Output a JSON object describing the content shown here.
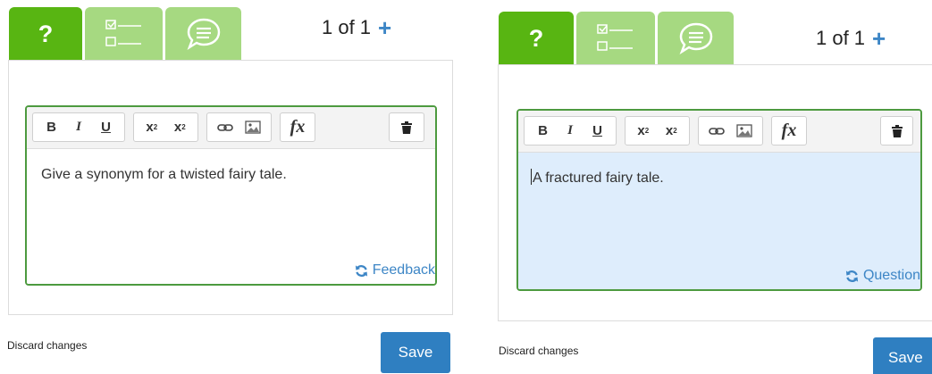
{
  "colors": {
    "tab_active": "#58b512",
    "tab_inactive": "#a6d981",
    "editor_border": "#4d9a3f",
    "link_blue": "#3d86c6",
    "save_button": "#2f7fc1",
    "answer_background": "#deedfc"
  },
  "panels": [
    {
      "tabs": [
        {
          "icon": "question-mark-icon",
          "label": "?",
          "active": true
        },
        {
          "icon": "checklist-icon",
          "active": false
        },
        {
          "icon": "speech-bubble-icon",
          "active": false
        }
      ],
      "counter": {
        "text": "1 of 1",
        "plus_icon": "plus-icon"
      },
      "toolbar": {
        "bold": "B",
        "italic": "I",
        "underline": "U",
        "superscript_icon": "superscript-icon",
        "subscript_icon": "subscript-icon",
        "link_icon": "link-icon",
        "image_icon": "image-icon",
        "formula": "fx",
        "delete_icon": "trash-icon"
      },
      "editor_text": "Give a synonym for a twisted fairy tale.",
      "switch_link": {
        "icon": "refresh-icon",
        "label": "Feedback"
      },
      "discard_label": "Discard changes",
      "save_label": "Save"
    },
    {
      "tabs": [
        {
          "icon": "question-mark-icon",
          "label": "?",
          "active": true
        },
        {
          "icon": "checklist-icon",
          "active": false
        },
        {
          "icon": "speech-bubble-icon",
          "active": false
        }
      ],
      "counter": {
        "text": "1 of 1",
        "plus_icon": "plus-icon"
      },
      "toolbar": {
        "bold": "B",
        "italic": "I",
        "underline": "U",
        "superscript_icon": "superscript-icon",
        "subscript_icon": "subscript-icon",
        "link_icon": "link-icon",
        "image_icon": "image-icon",
        "formula": "fx",
        "delete_icon": "trash-icon"
      },
      "editor_text": "A fractured fairy tale.",
      "switch_link": {
        "icon": "refresh-icon",
        "label": "Question"
      },
      "discard_label": "Discard changes",
      "save_label": "Save"
    }
  ]
}
